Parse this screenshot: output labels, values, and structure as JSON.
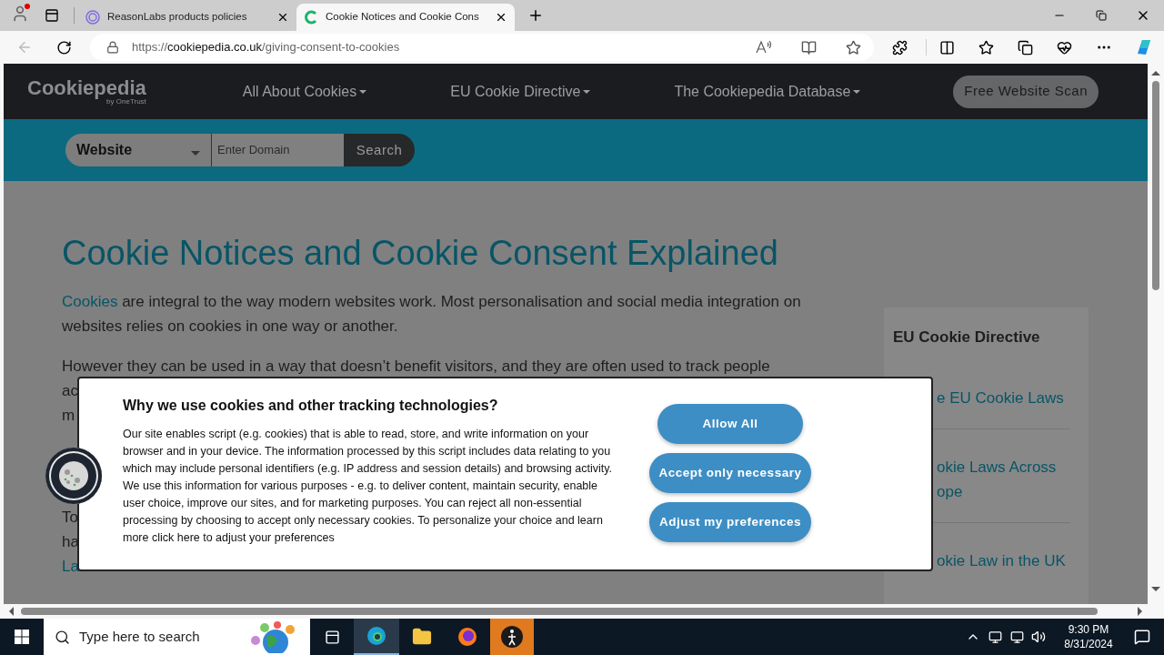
{
  "browser": {
    "tabs": [
      {
        "title": "ReasonLabs products policies",
        "selected": false
      },
      {
        "title": "Cookie Notices and Cookie Cons",
        "selected": true
      }
    ],
    "url": {
      "scheme": "https://",
      "host": "cookiepedia.co.uk",
      "path": "/giving-consent-to-cookies"
    }
  },
  "site": {
    "logo": "Cookiepedia",
    "logo_sub": "by OneTrust",
    "nav": [
      {
        "label": "All About Cookies"
      },
      {
        "label": "EU Cookie Directive"
      },
      {
        "label": "The Cookiepedia Database"
      }
    ],
    "scan_button": "Free Website Scan",
    "search": {
      "select": "Website",
      "placeholder": "Enter Domain",
      "button": "Search"
    }
  },
  "article": {
    "heading": "Cookie Notices and Cookie Consent Explained",
    "intro": {
      "link": "Cookies",
      "text": " are integral to the way modern websites work. Most personalisation and social media integration on websites relies on cookies in one way or another."
    },
    "partial_line": "However they can be used in a way that doesn’t benefit visitors, and they are often used to track people",
    "fragments": [
      {
        "text": "ac",
        "kind": "text"
      },
      {
        "text": "m",
        "kind": "text"
      },
      {
        "text": "To",
        "kind": "text"
      },
      {
        "text": "ha",
        "kind": "text"
      },
      {
        "text": "La",
        "kind": "link"
      }
    ]
  },
  "sidebar": {
    "title": "EU Cookie Directive",
    "links": [
      {
        "lines": [
          "e EU Cookie Laws"
        ]
      },
      {
        "lines": [
          "okie Laws Across",
          "ope"
        ]
      },
      {
        "lines": [
          "okie Law in the UK"
        ]
      }
    ]
  },
  "modal": {
    "title": "Why we use cookies and other tracking technologies?",
    "body": "Our site enables script (e.g. cookies) that is able to read, store, and write information on your browser and in your device. The information processed by this script includes data relating to you which may include personal identifiers (e.g. IP address and session details) and browsing activity. We use this information for various purposes - e.g. to deliver content, maintain security, enable user choice, improve our sites, and for marketing purposes. You can reject all non-essential processing by choosing to accept only necessary cookies. To personalize your choice and learn more click here to adjust your preferences",
    "buttons": [
      "Allow All",
      "Accept only necessary",
      "Adjust my preferences"
    ]
  },
  "taskbar": {
    "search_placeholder": "Type here to search",
    "time": "9:30 PM",
    "date": "8/31/2024"
  }
}
